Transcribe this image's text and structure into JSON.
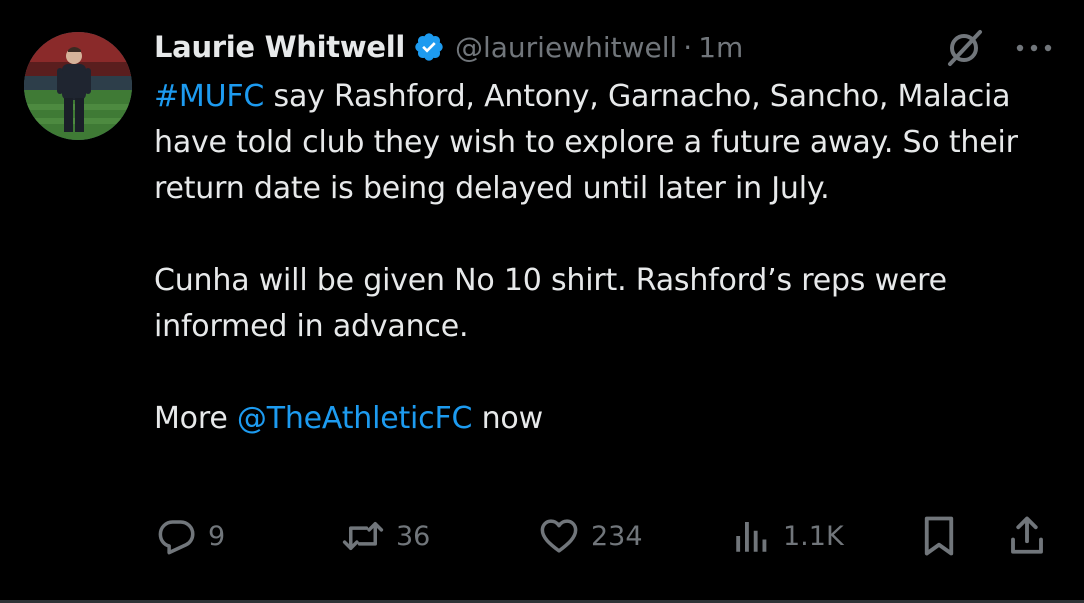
{
  "tweet": {
    "author": {
      "display_name": "Laurie Whitwell",
      "handle": "@lauriewhitwell",
      "separator": "·",
      "time": "1m",
      "verified": true
    },
    "body": {
      "line1_link": "#MUFC",
      "line1_rest": " say Rashford, Antony, Garnacho, Sancho, Malacia have told club they wish to explore a future away. So their return date is being delayed until later in July.",
      "para2": "Cunha will be given No 10 shirt. Rashford’s reps were informed in advance.",
      "para3_prefix": "More ",
      "para3_link": "@TheAthleticFC",
      "para3_suffix": " now"
    },
    "actions": {
      "replies": "9",
      "reposts": "36",
      "likes": "234",
      "views": "1.1K"
    },
    "icons": {
      "verified": "verified-badge-icon",
      "grok": "grok-icon",
      "more": "more-icon",
      "reply": "reply-icon",
      "repost": "repost-icon",
      "like": "heart-icon",
      "views": "views-icon",
      "bookmark": "bookmark-icon",
      "share": "share-icon"
    },
    "colors": {
      "background": "#000000",
      "text": "#e7e9ea",
      "secondary": "#71767b",
      "link": "#1d9bf0"
    }
  }
}
